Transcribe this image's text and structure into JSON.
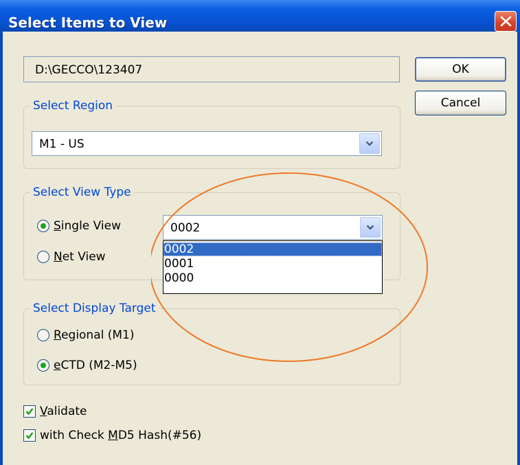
{
  "dialog": {
    "title": "Select Items to View",
    "path": "D:\\GECCO\\123407"
  },
  "buttons": {
    "ok": "OK",
    "cancel": "Cancel"
  },
  "region": {
    "label": "Select Region",
    "selected": "M1 - US"
  },
  "view_type": {
    "label": "Select View Type",
    "single_pre": "",
    "single_u": "S",
    "single_post": "ingle View",
    "net_pre": "",
    "net_u": "N",
    "net_post": "et View",
    "selected_option": "single",
    "combo_value": "0002",
    "dropdown_options": [
      "0002",
      "0001",
      "0000"
    ],
    "dropdown_highlighted": "0002"
  },
  "display_target": {
    "label": "Select Display Target",
    "regional_pre": "",
    "regional_u": "R",
    "regional_post": "egional (M1)",
    "ectd_pre": "",
    "ectd_u": "e",
    "ectd_post": "CTD (M2-M5)",
    "selected_option": "ectd"
  },
  "checks": {
    "validate_pre": "",
    "validate_u": "V",
    "validate_post": "alidate",
    "validate_checked": true,
    "md5_pre": "with Check ",
    "md5_u": "M",
    "md5_post": "D5 Hash(#56)",
    "md5_checked": true
  },
  "colors": {
    "title_bar": "#0850cf",
    "group_label": "#0046d5",
    "selection": "#316ac5",
    "annotation": "#ee7a28",
    "radio_dot": "#21a121"
  }
}
